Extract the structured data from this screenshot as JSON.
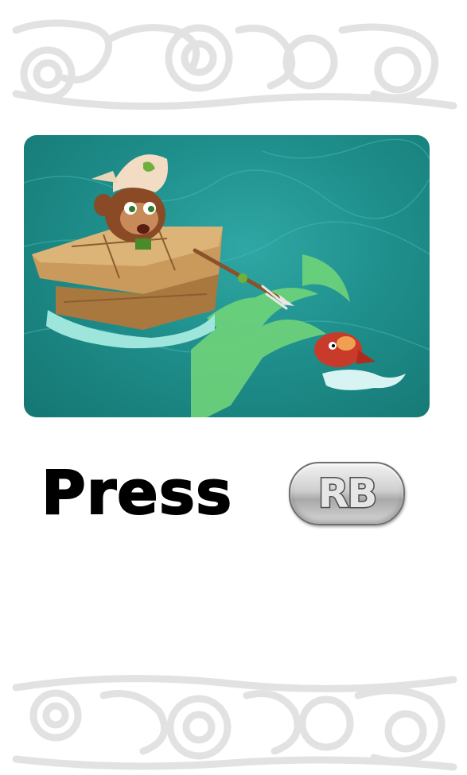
{
  "prompt": {
    "label": "Press",
    "button_label": "RB"
  },
  "scene": {
    "description_icon": "monkey-on-raft-spear-fish-illustration"
  },
  "colors": {
    "water": "#1f8f8c",
    "tattoo_green": "#6fd47a",
    "ornament": "#f0f0f0"
  }
}
